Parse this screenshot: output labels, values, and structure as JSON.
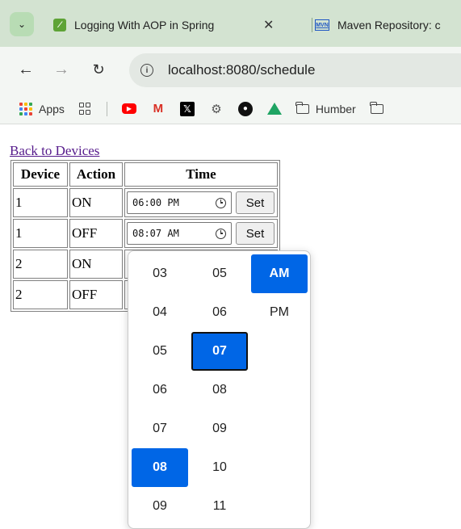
{
  "browser": {
    "tabs": [
      {
        "title": "Logging With AOP in Spring",
        "close": "✕"
      },
      {
        "title": "Maven Repository: c"
      }
    ],
    "url": "localhost:8080/schedule",
    "bookmarks": {
      "apps": "Apps",
      "folder1": "Humber"
    }
  },
  "page": {
    "back_link": "Back to Devices",
    "table": {
      "headers": {
        "device": "Device",
        "action": "Action",
        "time": "Time"
      },
      "rows": [
        {
          "device": "1",
          "action": "ON",
          "time": "06:00 PM",
          "set": "Set"
        },
        {
          "device": "1",
          "action": "OFF",
          "time": "08:07 AM",
          "set": "Set"
        },
        {
          "device": "2",
          "action": "ON"
        },
        {
          "device": "2",
          "action": "OFF"
        }
      ]
    }
  },
  "time_picker": {
    "hours": [
      "03",
      "04",
      "05",
      "06",
      "07",
      "08",
      "09"
    ],
    "minutes": [
      "05",
      "06",
      "07",
      "08",
      "09",
      "10",
      "11"
    ],
    "period": [
      "AM",
      "PM"
    ],
    "selected_hour": "08",
    "selected_minute": "07",
    "selected_period": "AM",
    "accent_color": "#0066e6"
  }
}
